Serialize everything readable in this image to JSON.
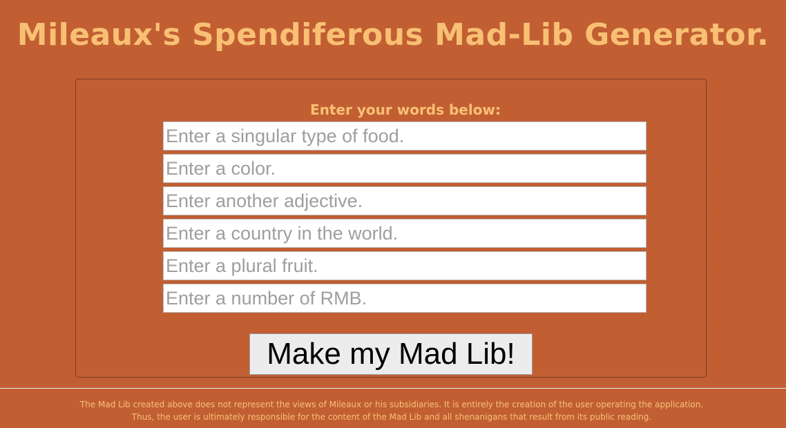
{
  "page": {
    "title": "Mileaux's Spendiferous Mad-Lib Generator."
  },
  "form": {
    "prompt": "Enter your words below:",
    "fields": [
      {
        "placeholder": "Enter a singular type of food.",
        "value": ""
      },
      {
        "placeholder": "Enter a color.",
        "value": ""
      },
      {
        "placeholder": "Enter another adjective.",
        "value": ""
      },
      {
        "placeholder": "Enter a country in the world.",
        "value": ""
      },
      {
        "placeholder": "Enter a plural fruit.",
        "value": ""
      },
      {
        "placeholder": "Enter a number of RMB.",
        "value": ""
      }
    ],
    "submit_label": "Make my Mad Lib!"
  },
  "footer": {
    "disclaimer": "The Mad Lib created above does not represent the views of Mileaux or his subsidiaries. It is entirely the creation of the user operating the application. Thus, the user is ultimately responsible for the content of the Mad Lib and all shenanigans that result from its public reading."
  },
  "colors": {
    "background": "#c15f33",
    "accent_text": "#f9c074",
    "field_background": "#ffffff",
    "placeholder_text": "#9e9e9e"
  }
}
